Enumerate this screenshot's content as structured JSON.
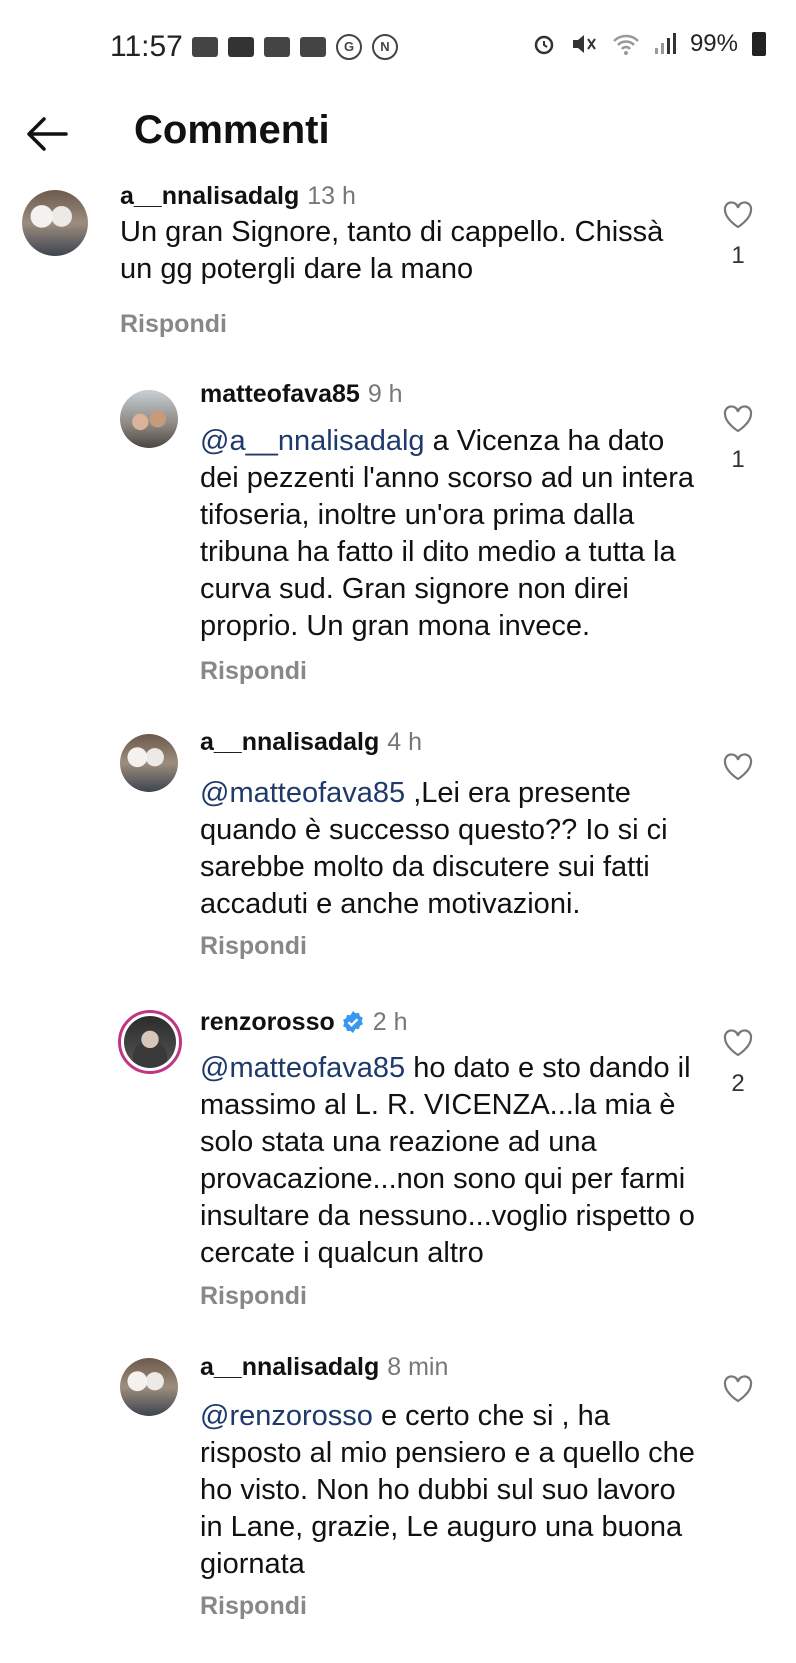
{
  "status_bar": {
    "time": "11:57",
    "battery": "99%",
    "notification_icons": [
      "app-notification-icon",
      "youtube-icon",
      "app-notification-icon",
      "app-notification-icon",
      "g-circle-icon",
      "n-circle-icon"
    ],
    "system_icons": [
      "alarm-icon",
      "mute-icon",
      "wifi-icon",
      "signal-icon",
      "battery-icon"
    ]
  },
  "header": {
    "title": "Commenti",
    "back_icon": "arrow-left-icon"
  },
  "reply_label": "Rispondi",
  "colors": {
    "mention": "#1f3a6a",
    "verified": "#3897f0",
    "story_ring": "#c13584"
  },
  "comments": [
    {
      "username": "a__nnalisadalg",
      "time": "13 h",
      "text": "Un gran Signore, tanto di cappello. Chissà un gg potergli dare la mano",
      "likes": "1"
    },
    {
      "username": "matteofava85",
      "time": "9 h",
      "mention": "@a__nnalisadalg",
      "text": " a Vicenza ha dato dei pezzenti l'anno scorso ad un intera tifoseria, inoltre un'ora prima dalla tribuna ha fatto il dito medio a tutta la curva sud. Gran signore non direi proprio. Un gran mona invece.",
      "likes": "1"
    },
    {
      "username": "a__nnalisadalg",
      "time": "4 h",
      "mention": "@matteofava85",
      "text": " ,Lei era presente quando è  successo  questo?? Io si ci sarebbe molto da discutere sui fatti accaduti e anche motivazioni.",
      "likes": ""
    },
    {
      "username": "renzorosso",
      "time": "2 h",
      "verified": true,
      "mention": "@matteofava85",
      "text": " ho dato e sto dando il massimo al L. R. VICENZA...la mia è solo stata una reazione ad una provacazione...non sono qui per farmi insultare da nessuno...voglio rispetto o cercate i qualcun altro",
      "likes": "2"
    },
    {
      "username": "a__nnalisadalg",
      "time": "8 min",
      "mention": "@renzorosso",
      "text": " e certo che si , ha risposto  al mio pensiero e a quello che ho visto. Non ho dubbi sul suo lavoro in Lane, grazie, Le auguro una buona  giornata",
      "likes": ""
    }
  ]
}
